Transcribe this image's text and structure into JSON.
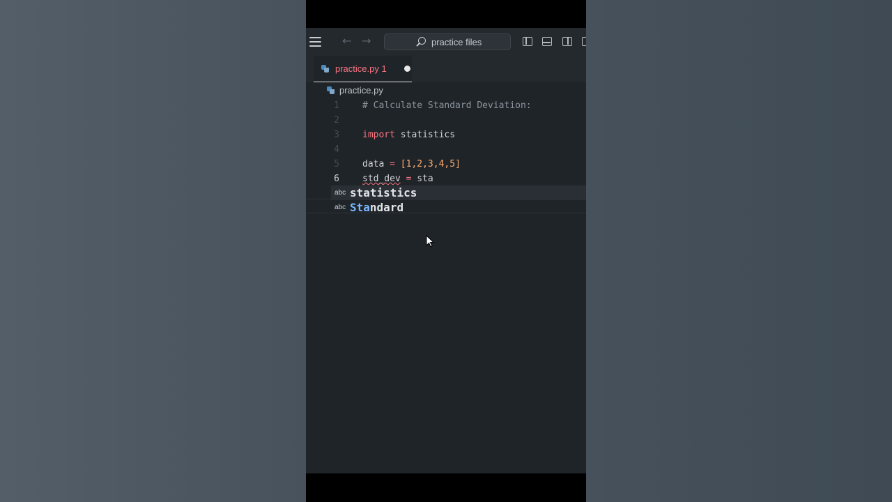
{
  "titlebar": {
    "search_placeholder": "practice files",
    "back_arrow": "←",
    "forward_arrow": "→"
  },
  "tab": {
    "filename": "practice.py",
    "problem_count": "1",
    "modified": true
  },
  "breadcrumb": {
    "file": "practice.py"
  },
  "editor": {
    "lines": [
      {
        "number": "1",
        "text": "# Calculate Standard Deviation:"
      },
      {
        "number": "2",
        "text": ""
      },
      {
        "number": "3",
        "keyword": "import",
        "rest": " statistics"
      },
      {
        "number": "4",
        "text": ""
      },
      {
        "number": "5",
        "var": "data",
        "op": " = ",
        "value": "[1,2,3,4,5]"
      },
      {
        "number": "6",
        "var": "std_dev",
        "op": " = ",
        "rest": "sta"
      }
    ],
    "active_line": "6"
  },
  "suggestions": [
    {
      "kind": "abc",
      "match": "sta",
      "rest": "tistics"
    },
    {
      "kind": "abc",
      "match": "Sta",
      "rest": "ndard"
    }
  ],
  "colors": {
    "editor_bg": "#1f2428",
    "keyword": "#f97583",
    "number": "#ffab70",
    "comment": "#8b949e"
  }
}
